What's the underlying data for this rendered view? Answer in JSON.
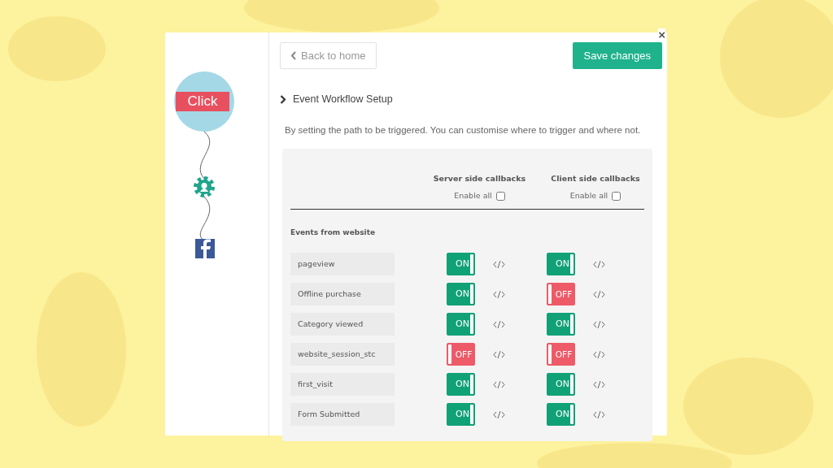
{
  "flow": {
    "trigger_label": "Click"
  },
  "close": "×",
  "back_button": "Back to home",
  "save_button": "Save changes",
  "section_title": "Event Workflow Setup",
  "description": "By setting the path to be triggered. You can customise where to trigger and where not.",
  "table": {
    "columns": [
      {
        "title": "Server side callbacks",
        "enable_all_label": "Enable all",
        "enable_all_checked": false
      },
      {
        "title": "Client side callbacks",
        "enable_all_label": "Enable all",
        "enable_all_checked": false
      }
    ],
    "group_title": "Events from website",
    "rows": [
      {
        "event": "pageview",
        "toggles": [
          {
            "on": true,
            "label": "ON"
          },
          {
            "on": true,
            "label": "ON"
          }
        ]
      },
      {
        "event": "Offline purchase",
        "toggles": [
          {
            "on": true,
            "label": "ON"
          },
          {
            "on": false,
            "label": "OFF"
          }
        ]
      },
      {
        "event": "Category viewed",
        "toggles": [
          {
            "on": true,
            "label": "ON"
          },
          {
            "on": true,
            "label": "ON"
          }
        ]
      },
      {
        "event": "website_session_stc",
        "toggles": [
          {
            "on": false,
            "label": "OFF"
          },
          {
            "on": false,
            "label": "OFF"
          }
        ]
      },
      {
        "event": "first_visit",
        "toggles": [
          {
            "on": true,
            "label": "ON"
          },
          {
            "on": true,
            "label": "ON"
          }
        ]
      },
      {
        "event": "Form Submitted",
        "toggles": [
          {
            "on": true,
            "label": "ON"
          },
          {
            "on": true,
            "label": "ON"
          }
        ]
      }
    ]
  }
}
